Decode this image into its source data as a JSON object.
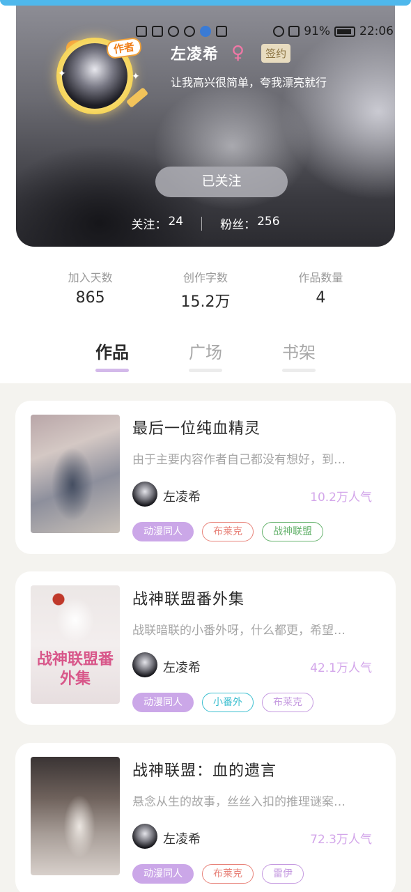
{
  "status_bar": {
    "battery": "91%",
    "time": "22:06"
  },
  "profile": {
    "author_tag": "作者",
    "name": "左凌希",
    "gender_symbol": "♀",
    "sign_badge": "签约",
    "bio": "让我高兴很简单，夸我漂亮就行",
    "follow_button": "已关注",
    "following_label": "关注：",
    "following_count": "24",
    "fans_label": "粉丝：",
    "fans_count": "256"
  },
  "stats": [
    {
      "label": "加入天数",
      "value": "865"
    },
    {
      "label": "创作字数",
      "value": "15.2万"
    },
    {
      "label": "作品数量",
      "value": "4"
    }
  ],
  "tabs": [
    {
      "label": "作品",
      "active": true
    },
    {
      "label": "广场",
      "active": false
    },
    {
      "label": "书架",
      "active": false
    }
  ],
  "books": [
    {
      "title": "最后一位纯血精灵",
      "desc": "由于主要内容作者自己都没有想好，到…",
      "author": "左凌希",
      "popularity": "10.2万人气",
      "tags": [
        {
          "text": "动漫同人",
          "style": "fill"
        },
        {
          "text": "布莱克",
          "style": "red"
        },
        {
          "text": "战神联盟",
          "style": "green"
        }
      ]
    },
    {
      "title": "战神联盟番外集",
      "desc": "战联暗联的小番外呀，什么都更，希望…",
      "author": "左凌希",
      "popularity": "42.1万人气",
      "cover_text": "战神联盟番外集",
      "tags": [
        {
          "text": "动漫同人",
          "style": "fill"
        },
        {
          "text": "小番外",
          "style": "cyan"
        },
        {
          "text": "布莱克",
          "style": "purple"
        }
      ]
    },
    {
      "title": "战神联盟：血的遗言",
      "desc": "悬念从生的故事，丝丝入扣的推理谜案…",
      "author": "左凌希",
      "popularity": "72.3万人气",
      "tags": [
        {
          "text": "动漫同人",
          "style": "fill"
        },
        {
          "text": "布莱克",
          "style": "red"
        },
        {
          "text": "雷伊",
          "style": "purple"
        }
      ]
    }
  ],
  "colors": {
    "accent": "#cba7e8",
    "popularity": "#d3a6ea",
    "status_bar_top": "#4fb8ec"
  }
}
